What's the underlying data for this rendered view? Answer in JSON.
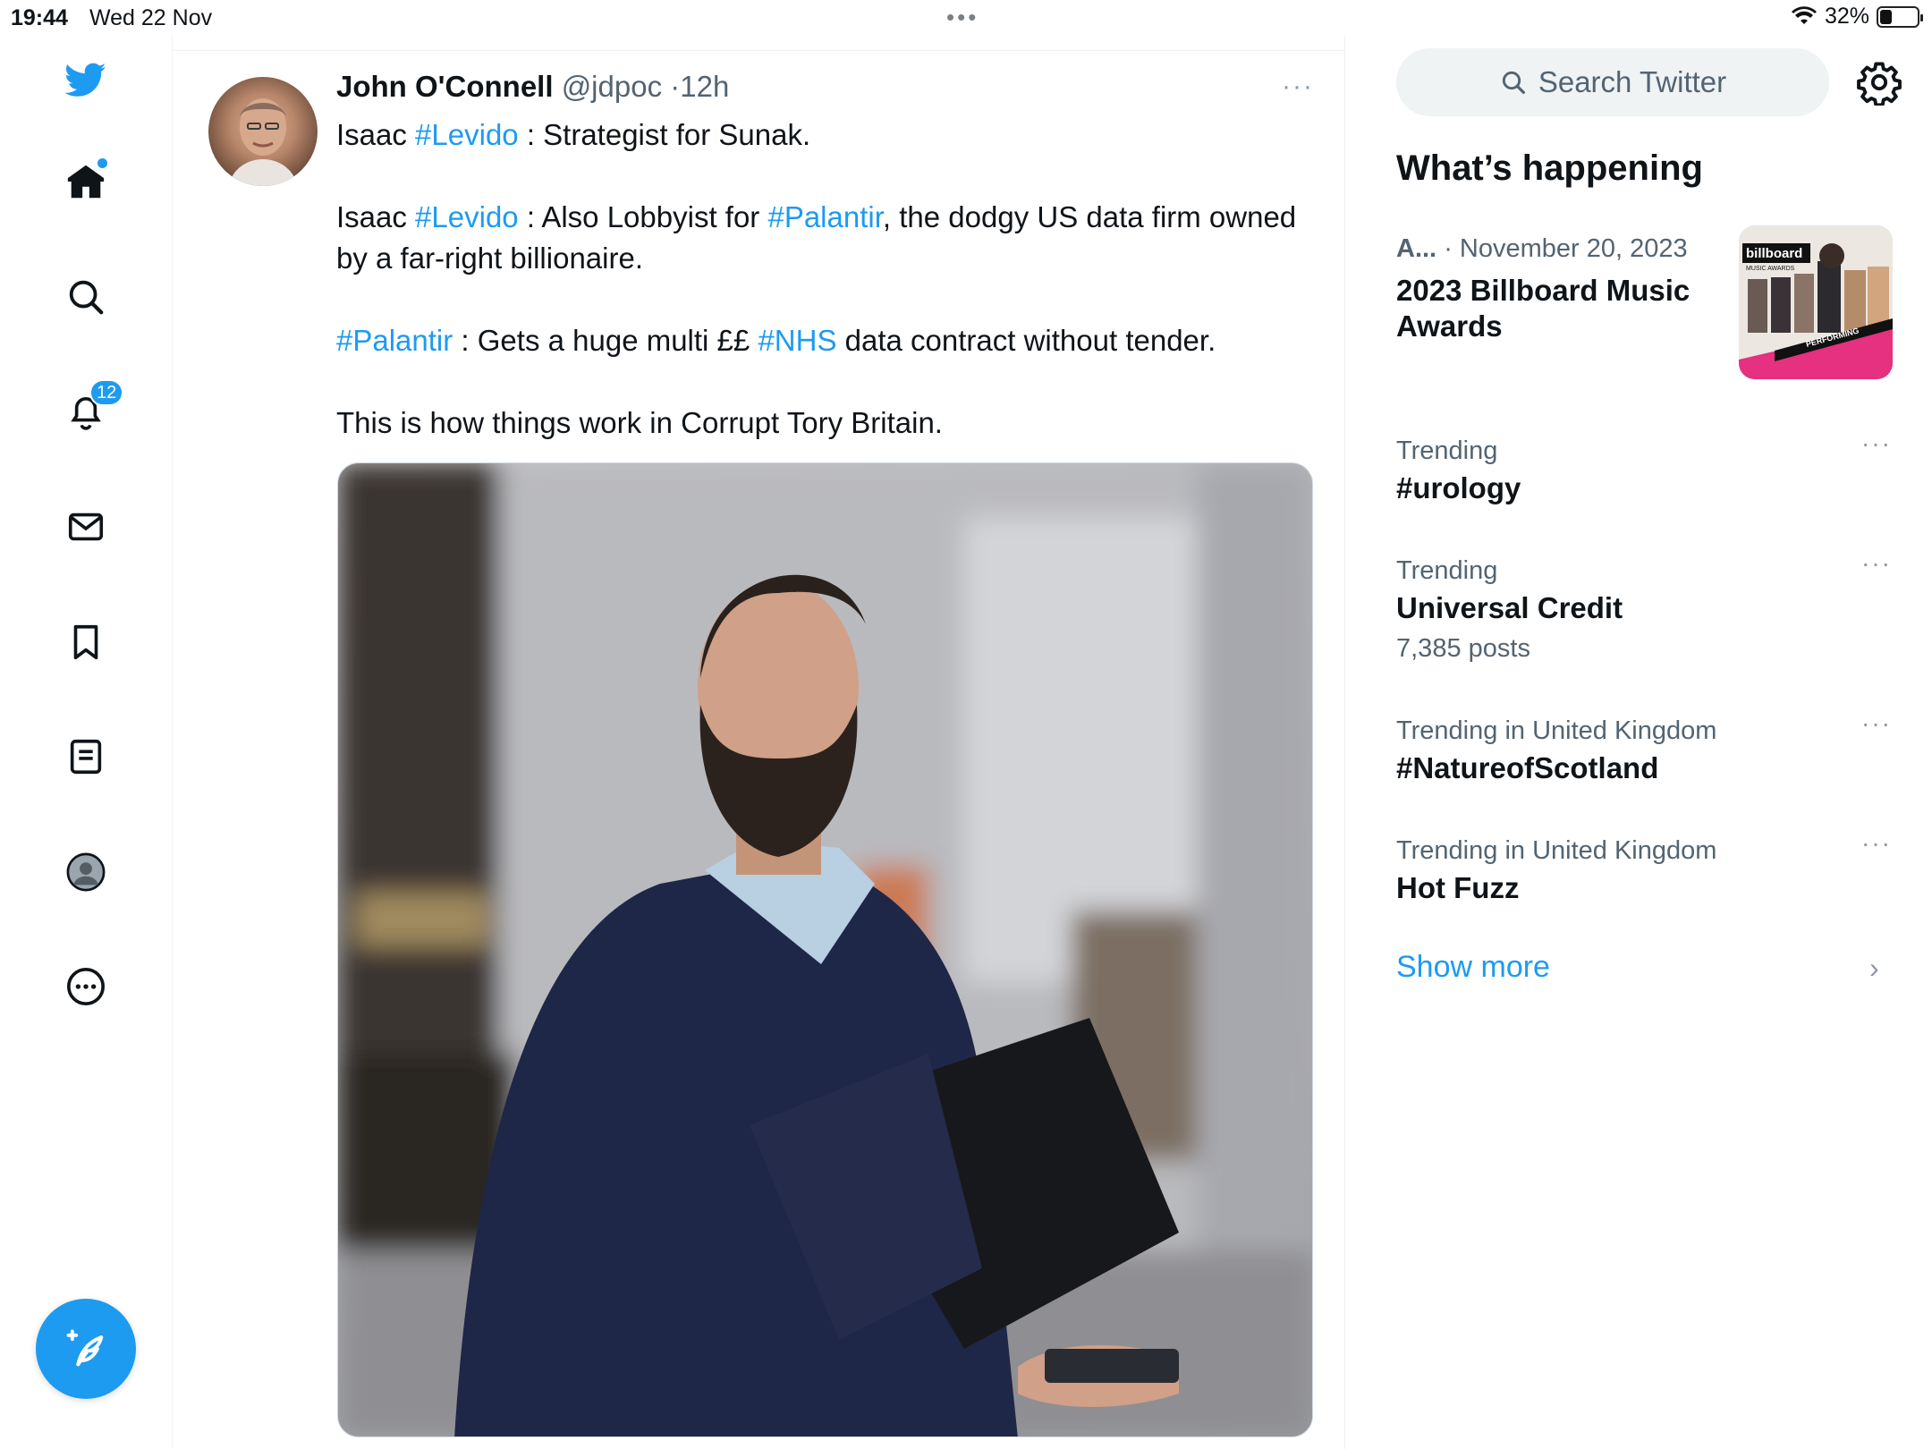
{
  "status": {
    "time": "19:44",
    "date": "Wed 22 Nov",
    "battery": "32%",
    "battery_level": 0.32
  },
  "nav": {
    "notifications_badge": "12"
  },
  "tweet": {
    "author_name": "John O'Connell",
    "author_handle": "@jdpoc",
    "separator": "·",
    "time": "12h",
    "more": "···",
    "lines": [
      {
        "parts": [
          {
            "t": "Isaac "
          },
          {
            "t": "#Levido",
            "tag": true
          },
          {
            "t": " : Strategist for Sunak."
          }
        ]
      },
      {
        "parts": [
          {
            "t": "Isaac "
          },
          {
            "t": "#Levido",
            "tag": true
          },
          {
            "t": " : Also Lobbyist for "
          },
          {
            "t": "#Palantir",
            "tag": true
          },
          {
            "t": ", the dodgy US data firm owned by a far-right billionaire."
          }
        ]
      },
      {
        "parts": [
          {
            "t": "#Palantir",
            "tag": true
          },
          {
            "t": " : Gets a huge multi ££ "
          },
          {
            "t": "#NHS",
            "tag": true
          },
          {
            "t": " data contract without tender."
          }
        ]
      },
      {
        "parts": [
          {
            "t": "This is how things work in Corrupt Tory Britain."
          }
        ]
      }
    ]
  },
  "search": {
    "placeholder": "Search Twitter"
  },
  "sidebar": {
    "title": "What’s happening",
    "news": {
      "source": "A...",
      "date": "· November 20, 2023",
      "title": "2023 Billboard Music Awards",
      "thumb_logo": "billboard",
      "thumb_sub": "MUSIC AWARDS",
      "thumb_banner": "PERFORMING"
    },
    "trends": [
      {
        "label": "Trending",
        "name": "#urology",
        "count": ""
      },
      {
        "label": "Trending",
        "name": "Universal Credit",
        "count": "7,385 posts"
      },
      {
        "label": "Trending in United Kingdom",
        "name": "#NatureofScotland",
        "count": ""
      },
      {
        "label": "Trending in United Kingdom",
        "name": "Hot Fuzz",
        "count": ""
      }
    ],
    "trend_more": "···",
    "show_more": "Show more",
    "show_more_chevron": "›"
  },
  "colors": {
    "accent": "#1d9bf0",
    "text": "#0f1419",
    "secondary": "#536471"
  }
}
